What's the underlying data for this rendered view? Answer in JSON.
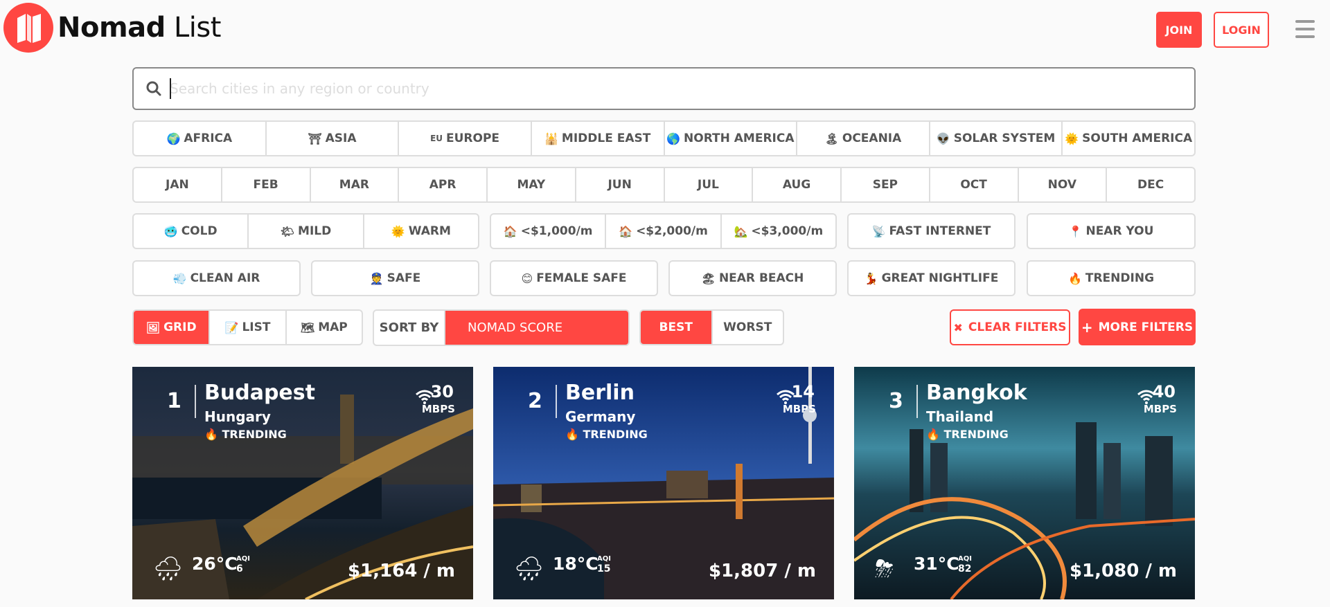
{
  "brand": {
    "name_bold": "Nomad",
    "name_light": "List",
    "accent": "#ff4742"
  },
  "header": {
    "join_label": "JOIN",
    "login_label": "LOGIN"
  },
  "search": {
    "placeholder": "Search cities in any region or country"
  },
  "regions": [
    {
      "emoji": "🌍",
      "label": "AFRICA"
    },
    {
      "emoji": "⛩",
      "label": "ASIA"
    },
    {
      "emoji": "EU",
      "label": "EUROPE"
    },
    {
      "emoji": "🕌",
      "label": "MIDDLE EAST"
    },
    {
      "emoji": "🌎",
      "label": "NORTH AMERICA"
    },
    {
      "emoji": "🏝",
      "label": "OCEANIA"
    },
    {
      "emoji": "👽",
      "label": "SOLAR SYSTEM"
    },
    {
      "emoji": "🌞",
      "label": "SOUTH AMERICA"
    }
  ],
  "months": [
    "JAN",
    "FEB",
    "MAR",
    "APR",
    "MAY",
    "JUN",
    "JUL",
    "AUG",
    "SEP",
    "OCT",
    "NOV",
    "DEC"
  ],
  "climate": [
    {
      "emoji": "🥶",
      "label": "COLD"
    },
    {
      "emoji": "🌤",
      "label": "MILD"
    },
    {
      "emoji": "🌞",
      "label": "WARM"
    }
  ],
  "cost": [
    {
      "emoji": "🏠",
      "label": "<$1,000/m"
    },
    {
      "emoji": "🏠",
      "label": "<$2,000/m"
    },
    {
      "emoji": "🏡",
      "label": "<$3,000/m"
    }
  ],
  "fast_internet": {
    "emoji": "📡",
    "label": "FAST INTERNET"
  },
  "near_you": {
    "emoji": "📍",
    "label": "NEAR YOU"
  },
  "filters_row": [
    {
      "emoji": "💨",
      "label": "CLEAN AIR"
    },
    {
      "emoji": "👮",
      "label": "SAFE"
    },
    {
      "emoji": "😊",
      "label": "FEMALE SAFE"
    },
    {
      "emoji": "🏖",
      "label": "NEAR BEACH"
    },
    {
      "emoji": "💃",
      "label": "GREAT NIGHTLIFE"
    },
    {
      "emoji": "🔥",
      "label": "TRENDING"
    }
  ],
  "views": [
    {
      "emoji": "🖼",
      "label": "GRID",
      "active": true
    },
    {
      "emoji": "📝",
      "label": "LIST",
      "active": false
    },
    {
      "emoji": "🗺",
      "label": "MAP",
      "active": false
    }
  ],
  "sort": {
    "label": "SORT BY",
    "value": "NOMAD SCORE"
  },
  "order": {
    "best": "BEST",
    "worst": "WORST"
  },
  "actions": {
    "clear": "CLEAR FILTERS",
    "more": "MORE FILTERS"
  },
  "cities": [
    {
      "rank": "1",
      "city": "Budapest",
      "country": "Hungary",
      "trend": "TRENDING",
      "speed": "30",
      "unit": "MBPS",
      "weather": "🌧",
      "temp": "26°C",
      "aqi_label": "AQI",
      "aqi": "6",
      "cost": "$1,164 / m"
    },
    {
      "rank": "2",
      "city": "Berlin",
      "country": "Germany",
      "trend": "TRENDING",
      "speed": "14",
      "unit": "MBPS",
      "weather": "🌧",
      "temp": "18°C",
      "aqi_label": "AQI",
      "aqi": "15",
      "cost": "$1,807 / m"
    },
    {
      "rank": "3",
      "city": "Bangkok",
      "country": "Thailand",
      "trend": "TRENDING",
      "speed": "40",
      "unit": "MBPS",
      "weather": "⛈",
      "temp": "31°C",
      "aqi_label": "AQI",
      "aqi": "82",
      "cost": "$1,080 / m"
    }
  ]
}
